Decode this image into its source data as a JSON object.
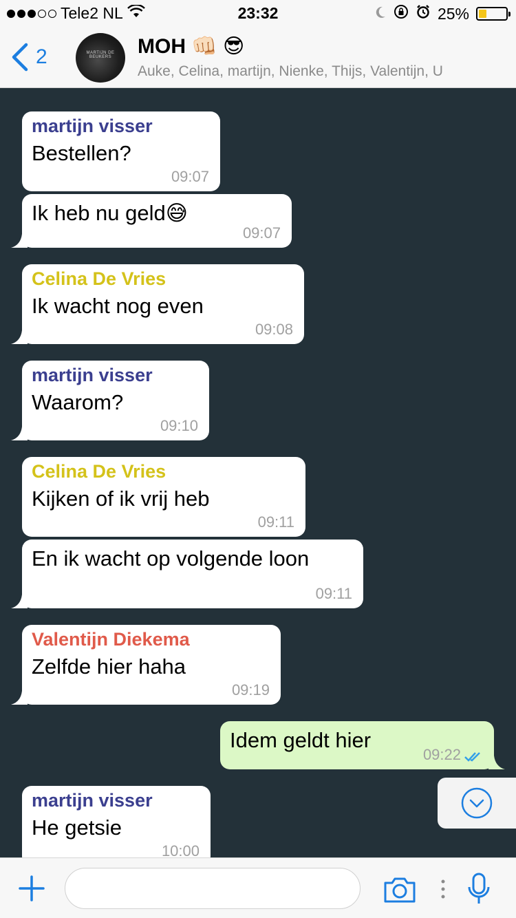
{
  "status_bar": {
    "carrier": "Tele2 NL",
    "time": "23:32",
    "battery": "25%",
    "battery_level": 0.25,
    "signal_bars_filled": 3,
    "signal_bars_total": 5
  },
  "header": {
    "back_count": "2",
    "title": "MOH 👊🏻 😎",
    "subtitle": "Auke, Celina, martijn, Nienke, Thijs, Valentijn, U",
    "avatar_text": "MARTIJN DE BEUKERS"
  },
  "colors": {
    "chat_background": "#233139",
    "incoming_bubble": "#ffffff",
    "outgoing_bubble": "#dcf8c6",
    "accent": "#1c7ee0",
    "sender_martijn": "#3b3f8f",
    "sender_celina": "#d4c21a",
    "sender_valentijn": "#e05a4a"
  },
  "messages": [
    {
      "sender": "martijn visser",
      "text": "Bestellen?",
      "time": "09:07"
    },
    {
      "sender": "",
      "text": "Ik heb nu geld😅",
      "time": "09:07"
    },
    {
      "sender": "Celina De Vries",
      "text": "Ik wacht nog even",
      "time": "09:08"
    },
    {
      "sender": "martijn visser",
      "text": "Waarom?",
      "time": "09:10"
    },
    {
      "sender": "Celina De Vries",
      "text": "Kijken of ik vrij heb",
      "time": "09:11"
    },
    {
      "sender": "",
      "text": "En ik wacht op volgende loon",
      "time": "09:11"
    },
    {
      "sender": "Valentijn Diekema",
      "text": "Zelfde hier haha",
      "time": "09:19"
    },
    {
      "sender": "",
      "text": "Idem geldt hier",
      "time": "09:22",
      "outgoing": true,
      "read": true
    },
    {
      "sender": "martijn visser",
      "text": "He getsie",
      "time": "10:00"
    }
  ],
  "input": {
    "placeholder": "",
    "value": ""
  }
}
